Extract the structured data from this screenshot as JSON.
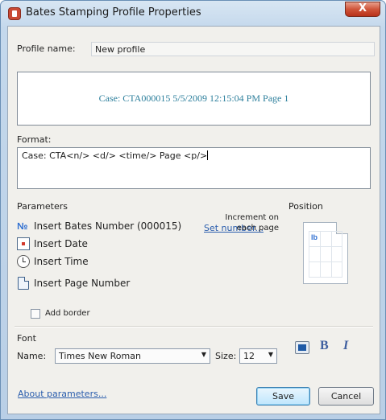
{
  "window": {
    "title": "Bates Stamping Profile Properties",
    "close_glyph": "X"
  },
  "profile": {
    "label": "Profile name:",
    "value": "New profile"
  },
  "preview": {
    "text": "Case: CTA000015    5/5/2009 12:15:04 PM    Page 1"
  },
  "format": {
    "label": "Format:",
    "value": "Case: CTA<n/>    <d/> <time/>   Page <p/>"
  },
  "parameters": {
    "title": "Parameters",
    "items": [
      {
        "label": "Insert Bates Number (000015)",
        "icon": "bates-number-icon"
      },
      {
        "label": "Insert Date",
        "icon": "calendar-icon"
      },
      {
        "label": "Insert Time",
        "icon": "clock-icon"
      },
      {
        "label": "Insert Page Number",
        "icon": "page-icon"
      }
    ],
    "set_number_link": "Set number...",
    "increment_note": "Increment on each page",
    "add_border_label": "Add border",
    "add_border_checked": false
  },
  "position": {
    "title": "Position",
    "marker": "lb"
  },
  "font": {
    "title": "Font",
    "name_label": "Name:",
    "name_value": "Times New Roman",
    "size_label": "Size:",
    "size_value": "12",
    "color": "#1f5aa6",
    "bold_glyph": "B",
    "italic_glyph": "I"
  },
  "footer": {
    "about_link": "About parameters...",
    "save_label": "Save",
    "cancel_label": "Cancel"
  }
}
